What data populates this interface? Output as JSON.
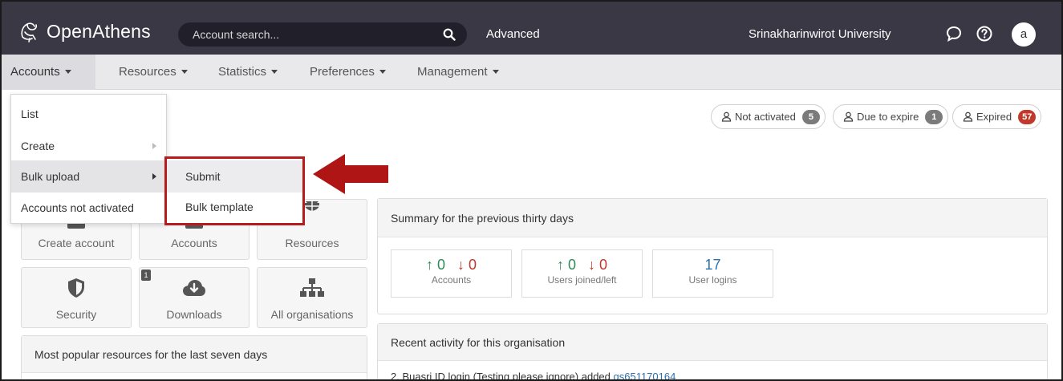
{
  "header": {
    "logo_text": "OpenAthens",
    "search_placeholder": "Account search...",
    "advanced_label": "Advanced",
    "organisation": "Srinakharinwirot University",
    "avatar_letter": "a"
  },
  "nav": {
    "items": [
      {
        "label": "Accounts"
      },
      {
        "label": "Resources"
      },
      {
        "label": "Statistics"
      },
      {
        "label": "Preferences"
      },
      {
        "label": "Management"
      }
    ]
  },
  "account_status": [
    {
      "label": "Not activated",
      "count": "5"
    },
    {
      "label": "Due to expire",
      "count": "1"
    },
    {
      "label": "Expired",
      "count": "57"
    }
  ],
  "accounts_menu": {
    "items": [
      {
        "label": "List"
      },
      {
        "label": "Create"
      },
      {
        "label": "Bulk upload"
      },
      {
        "label": "Accounts not activated"
      }
    ],
    "bulk_upload_submenu": [
      {
        "label": "Submit"
      },
      {
        "label": "Bulk template"
      }
    ]
  },
  "tiles": {
    "create_account": "Create account",
    "accounts": "Accounts",
    "resources": "Resources",
    "security": "Security",
    "downloads": "Downloads",
    "downloads_count": "1",
    "all_organisations": "All organisations"
  },
  "summary": {
    "title": "Summary for the previous thirty days",
    "accounts": {
      "up": "0",
      "down": "0",
      "label": "Accounts"
    },
    "users": {
      "up": "0",
      "down": "0",
      "label": "Users joined/left"
    },
    "logins": {
      "value": "17",
      "label": "User logins"
    }
  },
  "popular": {
    "title": "Most popular resources for the last seven days"
  },
  "activity": {
    "title": "Recent activity for this organisation",
    "entry_text": "2. Buasri ID login (Testing please ignore) added ",
    "entry_link": "gs651170164"
  },
  "colors": {
    "topbar": "#3b3845",
    "highlight_border": "#b71c1c",
    "up": "#2e8b57",
    "down": "#c0392b",
    "link": "#2a6fb0"
  }
}
